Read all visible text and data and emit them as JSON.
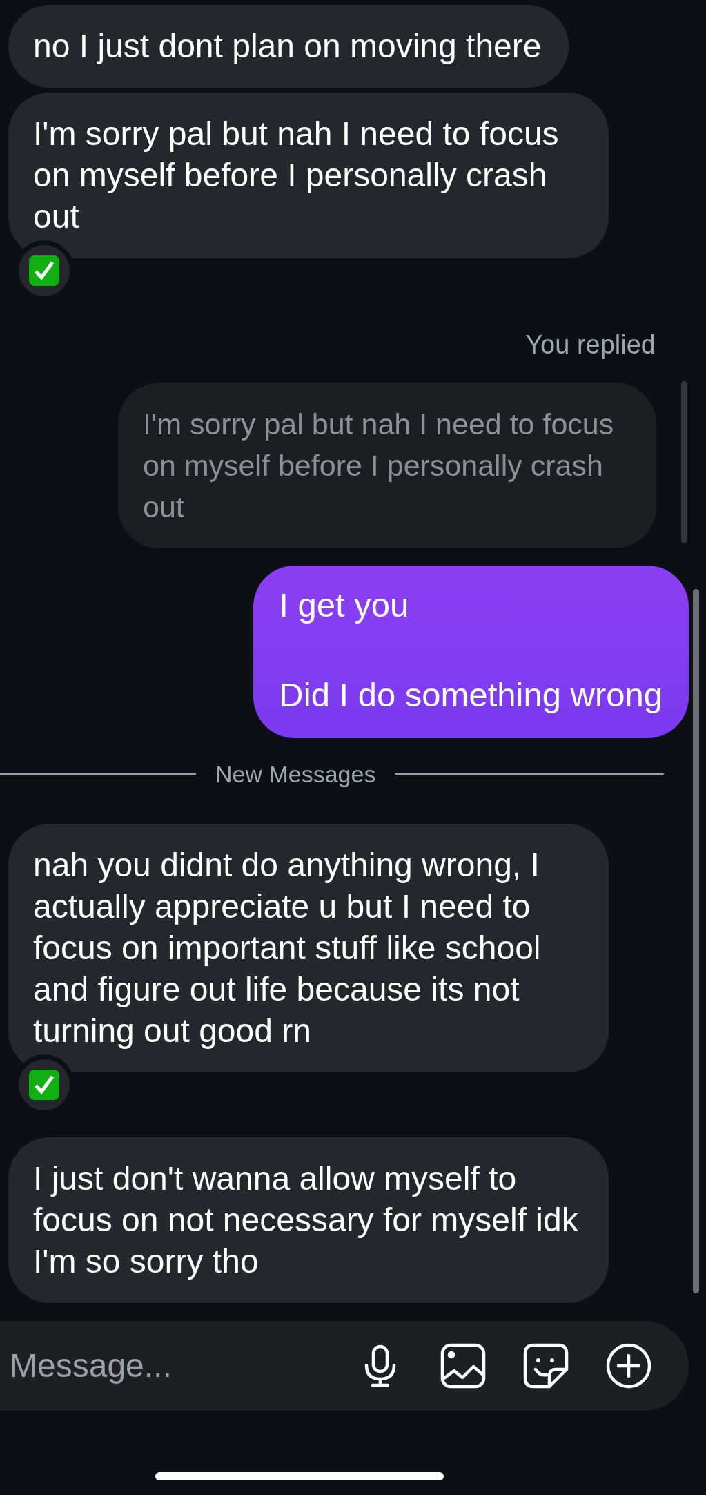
{
  "messages": [
    {
      "kind": "incoming",
      "text": "no I just dont plan on moving there",
      "reacted": false
    },
    {
      "kind": "incoming",
      "text": "I'm sorry pal but nah I need to focus on myself before I personally crash out",
      "reacted": true
    },
    {
      "kind": "reply_label",
      "text": "You replied"
    },
    {
      "kind": "quoted",
      "text": "I'm sorry pal but nah I need to focus on myself before I personally crash out"
    },
    {
      "kind": "outgoing",
      "text": "I get you\n\nDid I do something wrong"
    },
    {
      "kind": "divider",
      "text": "New Messages"
    },
    {
      "kind": "incoming",
      "text": "nah you didnt do anything wrong, I actually appreciate u but I need to focus on important stuff like school and figure out life because its not turning out good rn",
      "reacted": true
    },
    {
      "kind": "incoming",
      "text": "I just don't wanna allow myself to focus on not necessary for myself idk I'm so sorry tho",
      "reacted": false
    }
  ],
  "composer": {
    "placeholder": "Message..."
  }
}
